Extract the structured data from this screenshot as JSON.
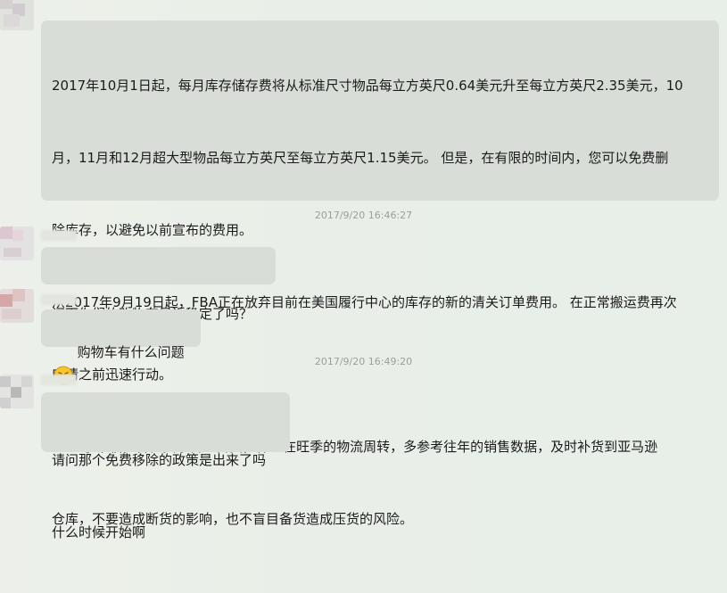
{
  "messages": [
    {
      "id": "msg-1",
      "lines": [
        "2017年10月1日起，每月库存储存费将从标准尺寸物品每立方英尺0.64美元升至每立方英尺2.35美元，10",
        "月，11月和12月超大型物品每立方英尺至每立方英尺1.15美元。 但是，在有限的时间内，您可以免费删",
        "除库存，以避免以前宣布的费用。",
        "从2017年9月19日起，FBA正在放弃目前在美国履行中心的库存的新的清关订单费用。 在正常搬运费再次",
        "申请之前迅速行动。",
        "    旺季来临，各位卖家合理备货，保证在旺季的物流周转，多参考往年的销售数据，及时补货到亚马逊",
        "仓库，不要造成断货的影响，也不盲目备货造成压货的风险。"
      ]
    },
    {
      "id": "time-1",
      "time": "2017/9/20 16:46:27"
    },
    {
      "id": "msg-2",
      "lines": [
        "问下你们的购物车最近稳定了吗？"
      ]
    },
    {
      "id": "msg-3",
      "lines": [
        "购物车有什么问题"
      ],
      "emoji": "sad-face-emoji"
    },
    {
      "id": "time-2",
      "time": "2017/9/20 16:49:20"
    },
    {
      "id": "msg-4",
      "lines": [
        "请问那个免费移除的政策是出来了吗",
        "什么时候开始啊"
      ]
    }
  ],
  "colors": {
    "bubble": "#d9ddd8",
    "background": "#e9efe8",
    "timestamp": "#9aa09a"
  }
}
